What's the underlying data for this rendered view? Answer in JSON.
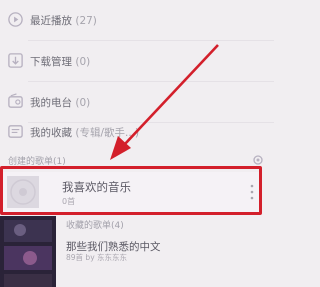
{
  "menu": {
    "items": [
      {
        "label": "最近播放",
        "count": "(27)",
        "icon": "play-circle-icon"
      },
      {
        "label": "下载管理",
        "count": "(0)",
        "icon": "download-icon"
      },
      {
        "label": "我的电台",
        "count": "(0)",
        "icon": "radio-icon"
      },
      {
        "label": "我的收藏",
        "count": "(专辑/歌手...)",
        "icon": "collection-icon"
      }
    ]
  },
  "section": {
    "label": "创建的歌单(1)",
    "icon": "gear-icon"
  },
  "playlist": {
    "title": "我喜欢的音乐",
    "subtitle": "0首",
    "icon": "more-vertical-icon"
  },
  "recommend": {
    "header": "收藏的歌单(4)",
    "items": [
      {
        "title": "那些我们熟悉的中文",
        "subtitle": "89首 by 东东东东"
      },
      {
        "title": "",
        "subtitle": ""
      }
    ]
  },
  "colors": {
    "accent": "#d31f2b",
    "icon": "#b7b1c0",
    "text": "#6f6e78"
  }
}
